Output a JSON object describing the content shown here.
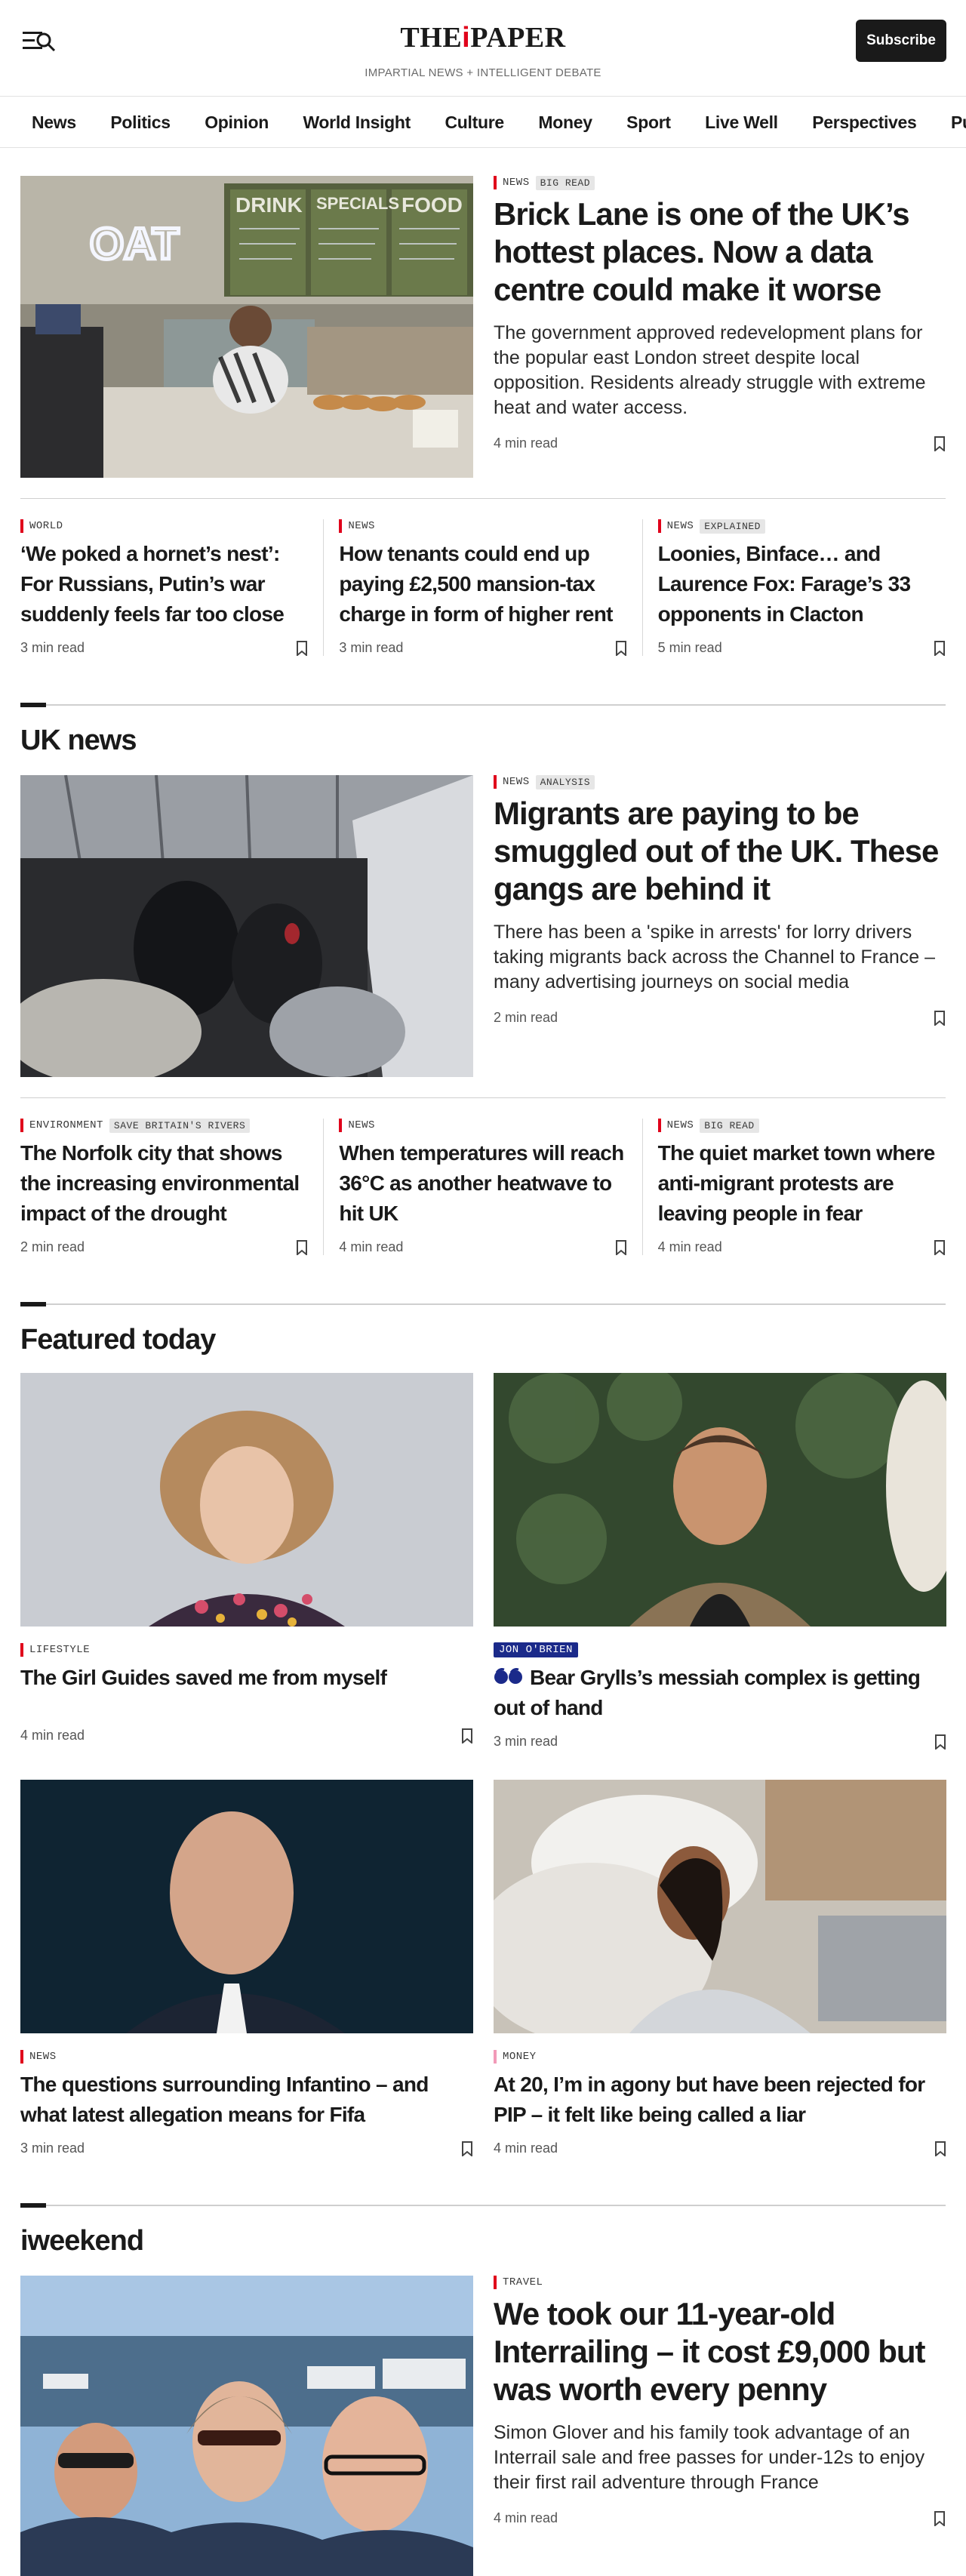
{
  "header": {
    "logo_prefix": "THE",
    "logo_mark": "i",
    "logo_suffix": "PAPER",
    "tagline": "IMPARTIAL NEWS + INTELLIGENT DEBATE",
    "subscribe_label": "Subscribe"
  },
  "nav": [
    "News",
    "Politics",
    "Opinion",
    "World Insight",
    "Culture",
    "Money",
    "Sport",
    "Live Well",
    "Perspectives",
    "Puzzles"
  ],
  "lead": {
    "category": "NEWS",
    "label": "BIG READ",
    "headline": "Brick Lane is one of the UK’s hottest places. Now a data centre could make it worse",
    "standfirst": "The government approved redevelopment plans for the popular east London street despite local opposition. Residents already struggle with extreme heat and water access.",
    "read_time": "4 min read",
    "image_signs": {
      "neon": "OAT",
      "board1": "DRINK",
      "board2": "SPECIALS",
      "board3": "FOOD"
    }
  },
  "top_stories": [
    {
      "category": "WORLD",
      "label": "",
      "headline": "‘We poked a hornet’s nest’: For Russians, Putin’s war suddenly feels far too close",
      "read_time": "3 min read"
    },
    {
      "category": "NEWS",
      "label": "",
      "headline": "How tenants could end up paying £2,500 mansion-tax charge in form of higher rent",
      "read_time": "3 min read"
    },
    {
      "category": "NEWS",
      "label": "EXPLAINED",
      "headline": "Loonies, Binface… and Laurence Fox: Farage’s 33 opponents in Clacton",
      "read_time": "5 min read"
    }
  ],
  "uk_news": {
    "title": "UK news",
    "lead": {
      "category": "NEWS",
      "label": "ANALYSIS",
      "headline": "Migrants are paying to be smuggled out of the UK. These gangs are behind it",
      "standfirst": "There has been a 'spike in arrests' for lorry drivers taking migrants back across the Channel to France –many advertising journeys on social media",
      "read_time": "2 min read"
    },
    "stories": [
      {
        "category": "ENVIRONMENT",
        "label": "SAVE BRITAIN'S RIVERS",
        "headline": "The Norfolk city that shows the increasing environmental impact of the drought",
        "read_time": "2 min read"
      },
      {
        "category": "NEWS",
        "label": "",
        "headline": "When temperatures will reach 36°C as another heatwave to hit UK",
        "read_time": "4 min read"
      },
      {
        "category": "NEWS",
        "label": "BIG READ",
        "headline": "The quiet market town where anti-migrant protests are leaving people in fear",
        "read_time": "4 min read"
      }
    ]
  },
  "featured": {
    "title": "Featured today",
    "cards": [
      {
        "category": "LIFESTYLE",
        "author": "",
        "headline": "The Girl Guides saved me from myself",
        "read_time": "4 min read"
      },
      {
        "category": "",
        "author": "JON O'BRIEN",
        "headline": "Bear Grylls’s messiah complex is getting out of hand",
        "read_time": "3 min read"
      },
      {
        "category": "NEWS",
        "author": "",
        "headline": "The questions surrounding Infantino – and what latest allegation means for Fifa",
        "read_time": "3 min read"
      },
      {
        "category": "MONEY",
        "author": "",
        "headline": "At 20, I’m in agony but have been rejected for PIP – it felt like being called a liar",
        "read_time": "4 min read"
      }
    ]
  },
  "iweekend": {
    "title": "iweekend",
    "lead": {
      "category": "TRAVEL",
      "headline": "We took our 11-year-old Interrailing – it cost £9,000 but was worth every penny",
      "standfirst": "Simon Glover and his family took advantage of an Interrail sale and free passes for under-12s to enjoy their first rail adventure through France",
      "read_time": "4 min read"
    }
  },
  "colors": {
    "accent_red": "#e0001b",
    "money_pink": "#f29ab8",
    "author_blue": "#1b2a8a",
    "ink": "#1a1a1a"
  }
}
